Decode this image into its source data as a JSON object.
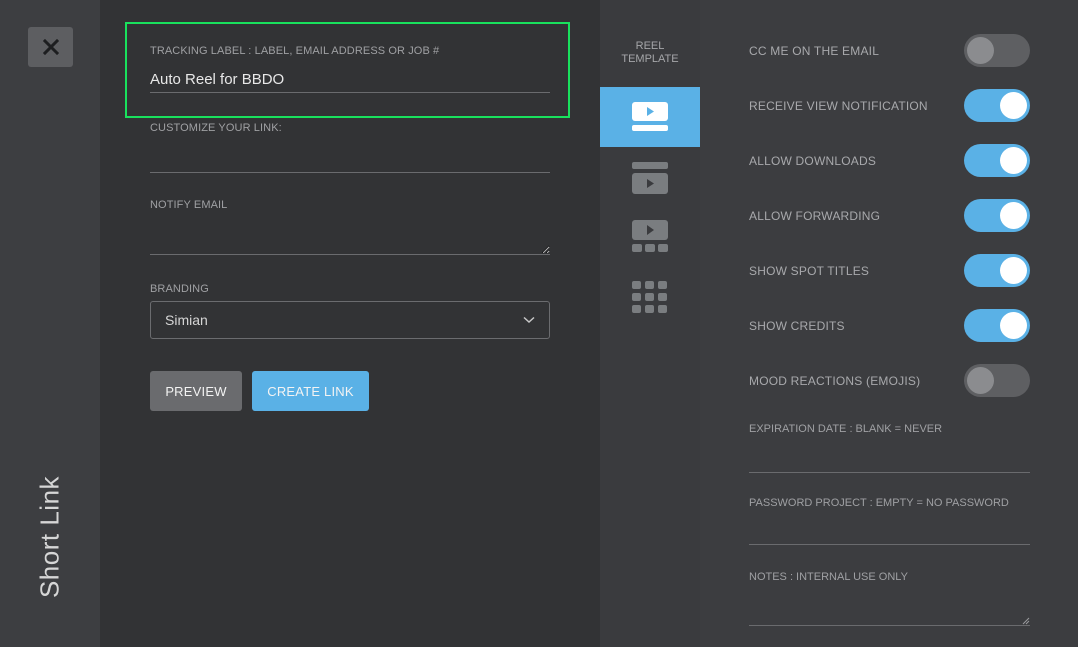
{
  "rail": {
    "close_icon": "close-icon",
    "title": "Short Link"
  },
  "form": {
    "tracking_label": "TRACKING LABEL : LABEL, EMAIL ADDRESS OR JOB #",
    "tracking_value": "Auto Reel for BBDO",
    "customize_label": "CUSTOMIZE YOUR LINK:",
    "customize_value": "",
    "notify_label": "NOTIFY EMAIL",
    "notify_value": "",
    "branding_label": "BRANDING",
    "branding_value": "Simian",
    "preview_label": "PREVIEW",
    "create_label": "CREATE LINK"
  },
  "template": {
    "title_line1": "REEL",
    "title_line2": "TEMPLATE",
    "options": [
      {
        "icon": "player-bottom-bar-icon",
        "active": true
      },
      {
        "icon": "player-top-bar-icon",
        "active": false
      },
      {
        "icon": "player-thumbnails-icon",
        "active": false
      },
      {
        "icon": "grid-icon",
        "active": false
      }
    ]
  },
  "settings": {
    "toggles": [
      {
        "label": "CC ME ON THE EMAIL",
        "on": false
      },
      {
        "label": "RECEIVE VIEW NOTIFICATION",
        "on": true
      },
      {
        "label": "ALLOW DOWNLOADS",
        "on": true
      },
      {
        "label": "ALLOW FORWARDING",
        "on": true
      },
      {
        "label": "SHOW SPOT TITLES",
        "on": true
      },
      {
        "label": "SHOW CREDITS",
        "on": true
      },
      {
        "label": "MOOD REACTIONS (EMOJIS)",
        "on": false
      }
    ],
    "expiration_label": "EXPIRATION DATE : BLANK = NEVER",
    "password_label": "PASSWORD PROJECT : EMPTY = NO PASSWORD",
    "notes_label": "NOTES : INTERNAL USE ONLY"
  },
  "colors": {
    "accent": "#5ab1e6",
    "highlight": "#19e15d",
    "panel": "#323335"
  }
}
